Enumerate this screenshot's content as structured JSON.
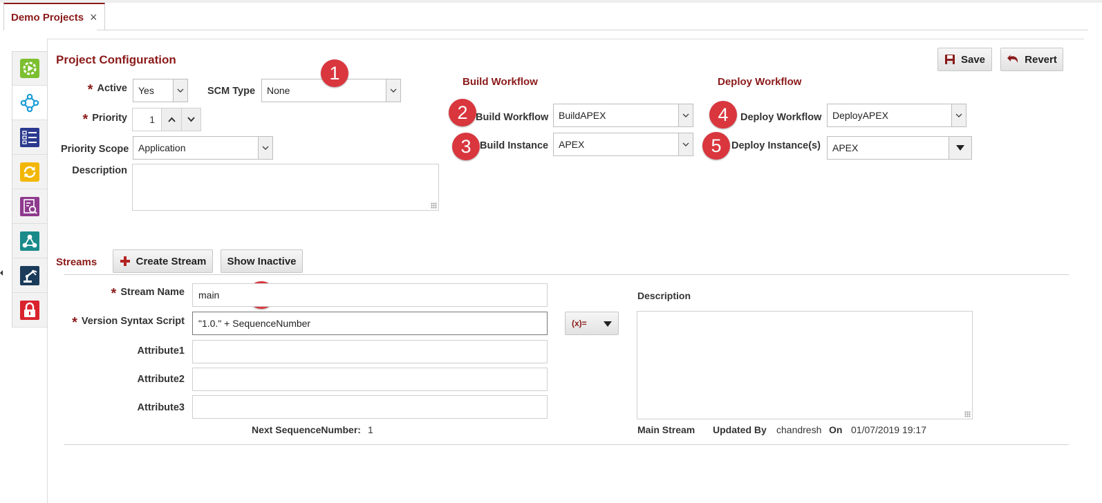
{
  "tab": {
    "title": "Demo Projects",
    "close": "×"
  },
  "toolbar": {
    "save_label": "Save",
    "revert_label": "Revert"
  },
  "sidebar": {
    "items": [
      {
        "icon": "play-gear-icon",
        "color": "#7cbf2f"
      },
      {
        "icon": "network-icon",
        "color": "#1a9bd7"
      },
      {
        "icon": "list-icon",
        "color": "#2b3a8f"
      },
      {
        "icon": "sync-icon",
        "color": "#f2b705"
      },
      {
        "icon": "report-icon",
        "color": "#8e3a8e"
      },
      {
        "icon": "share-nodes-icon",
        "color": "#1a8a8a"
      },
      {
        "icon": "robot-arm-icon",
        "color": "#1b3b5a"
      },
      {
        "icon": "lock-icon",
        "color": "#d9232d"
      }
    ],
    "active_index": 1
  },
  "project_configuration": {
    "title": "Project Configuration",
    "active": {
      "label": "Active",
      "value": "Yes"
    },
    "scm_type": {
      "label": "SCM Type",
      "value": "None"
    },
    "priority": {
      "label": "Priority",
      "value": "1"
    },
    "priority_scope": {
      "label": "Priority Scope",
      "value": "Application"
    },
    "description": {
      "label": "Description",
      "value": ""
    }
  },
  "build_workflow": {
    "title": "Build Workflow",
    "workflow": {
      "label": "Build Workflow",
      "value": "BuildAPEX"
    },
    "instance": {
      "label": "Build Instance",
      "value": "APEX"
    }
  },
  "deploy_workflow": {
    "title": "Deploy Workflow",
    "workflow": {
      "label": "Deploy Workflow",
      "value": "DeployAPEX"
    },
    "instances": {
      "label": "Deploy Instance(s)",
      "value": "APEX"
    }
  },
  "badges": [
    "1",
    "2",
    "3",
    "4",
    "5",
    "6"
  ],
  "streams": {
    "title": "Streams",
    "create_label": "Create Stream",
    "show_inactive_label": "Show Inactive",
    "stream_name": {
      "label": "Stream Name",
      "value": "main"
    },
    "version_syntax": {
      "label": "Version Syntax Script",
      "value": "\"1.0.\" + SequenceNumber",
      "fx_label": "(x)="
    },
    "attribute1": {
      "label": "Attribute1",
      "value": ""
    },
    "attribute2": {
      "label": "Attribute2",
      "value": ""
    },
    "attribute3": {
      "label": "Attribute3",
      "value": ""
    },
    "next_sequence": {
      "label": "Next SequenceNumber:",
      "value": "1"
    },
    "description": {
      "label": "Description",
      "value": ""
    },
    "footer": {
      "main_stream": "Main Stream",
      "updated_by_label": "Updated By",
      "updated_by": "chandresh",
      "on_label": "On",
      "on_value": "01/07/2019 19:17"
    }
  },
  "colors": {
    "accent": "#8b1a1a",
    "badge": "#d9363e"
  }
}
